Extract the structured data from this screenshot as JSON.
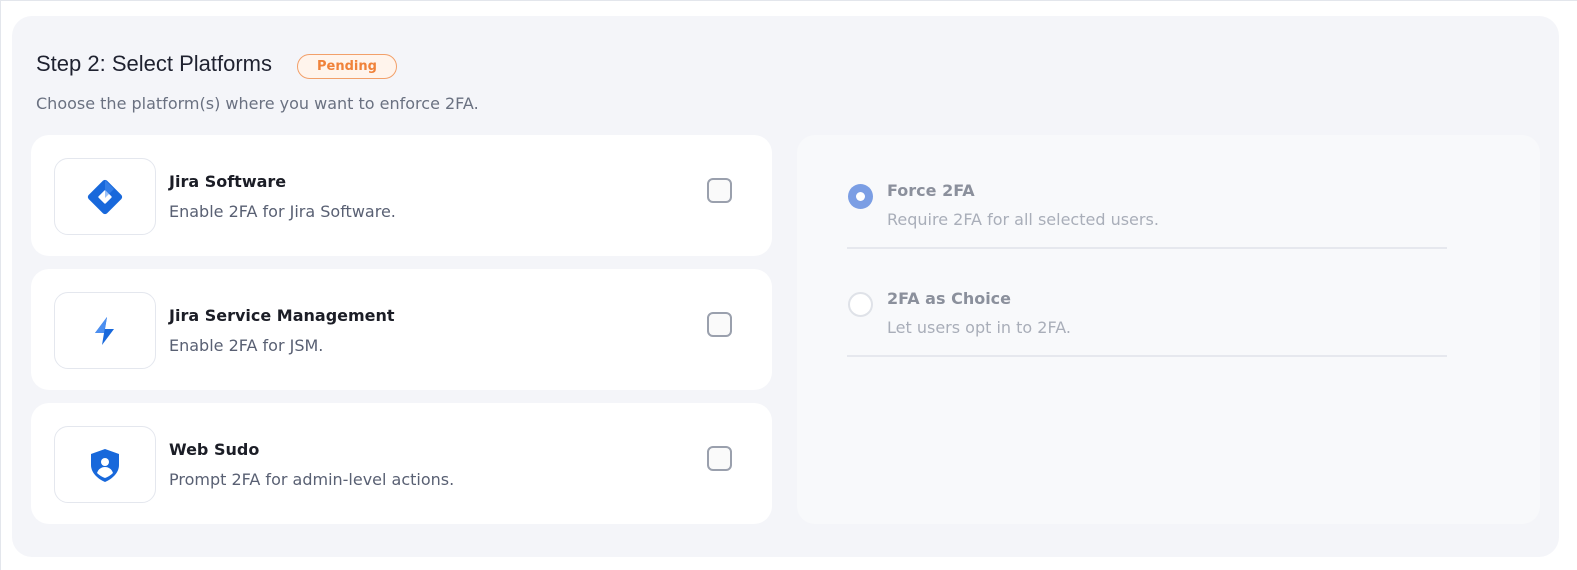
{
  "step": {
    "title": "Step 2: Select Platforms",
    "status": "Pending",
    "subtitle": "Choose the platform(s) where you want to enforce 2FA."
  },
  "platforms": [
    {
      "name": "Jira Software",
      "description": "Enable 2FA for Jira Software.",
      "icon": "jira-software-icon",
      "checked": false
    },
    {
      "name": "Jira Service Management",
      "description": "Enable 2FA for JSM.",
      "icon": "jira-service-management-icon",
      "checked": false
    },
    {
      "name": "Web Sudo",
      "description": "Prompt 2FA for admin-level actions.",
      "icon": "web-sudo-shield-icon",
      "checked": false
    }
  ],
  "enforcement": {
    "options": [
      {
        "label": "Force 2FA",
        "description": "Require 2FA for all selected users.",
        "selected": true
      },
      {
        "label": "2FA as Choice",
        "description": "Let users opt in to 2FA.",
        "selected": false
      }
    ]
  },
  "colors": {
    "accent": "#1868db",
    "pending": "#f0823a",
    "radio_selected": "#7b9ee4",
    "panel_bg": "#f4f5f9"
  }
}
